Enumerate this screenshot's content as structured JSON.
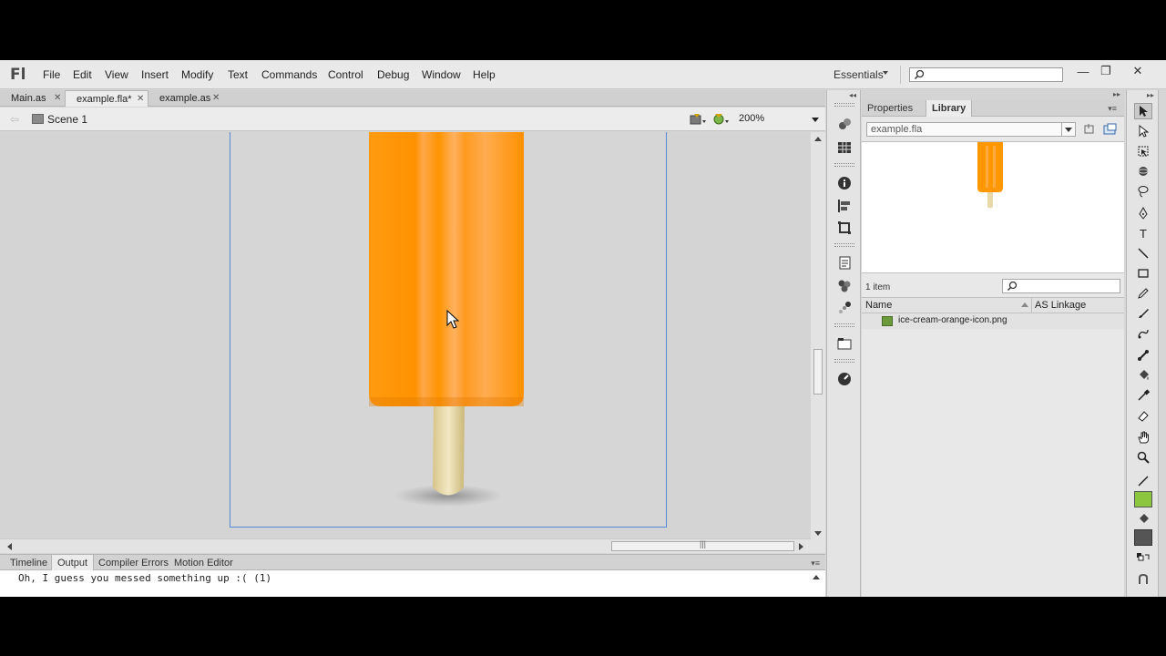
{
  "app": {
    "logo": "Fl",
    "workspace": "Essentials",
    "search_placeholder": ""
  },
  "menu": [
    "File",
    "Edit",
    "View",
    "Insert",
    "Modify",
    "Text",
    "Commands",
    "Control",
    "Debug",
    "Window",
    "Help"
  ],
  "window_controls": {
    "minimize": "—",
    "maximize": "❐",
    "close": "✕"
  },
  "document_tabs": [
    {
      "label": "Main.as",
      "active": false
    },
    {
      "label": "example.fla*",
      "active": true
    },
    {
      "label": "example.as",
      "active": false
    }
  ],
  "scene": {
    "back_icon": "arrow-left-icon",
    "label": "Scene 1"
  },
  "zoom": {
    "value": "200%"
  },
  "bottom_panel": {
    "tabs": [
      {
        "label": "Timeline",
        "active": false
      },
      {
        "label": "Output",
        "active": true
      },
      {
        "label": "Compiler Errors",
        "active": false
      },
      {
        "label": "Motion Editor",
        "active": false
      }
    ],
    "output_text": "Oh, I guess you messed something up :( (1)"
  },
  "library": {
    "tabs": [
      {
        "label": "Properties",
        "active": false
      },
      {
        "label": "Library",
        "active": true
      }
    ],
    "document": "example.fla",
    "item_count": "1 item",
    "columns": {
      "name": "Name",
      "linkage": "AS Linkage"
    },
    "items": [
      {
        "name": "ice-cream-orange-icon.png",
        "linkage": ""
      }
    ]
  },
  "colors": {
    "accent_stage_border": "#5b86d6",
    "popsicle": "#ff9800",
    "stick": "#e8d9a8",
    "fill_color": "#8cc63f",
    "stroke_color": "#4a4a4a"
  }
}
